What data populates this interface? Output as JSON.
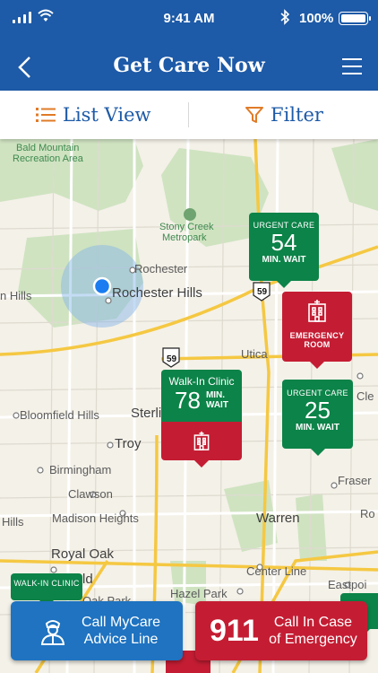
{
  "status_bar": {
    "time": "9:41 AM",
    "battery": "100%"
  },
  "header": {
    "title": "Get Care Now"
  },
  "subbar": {
    "list_view": "List View",
    "filter": "Filter"
  },
  "map_labels": {
    "bald_mountain_1": "Bald Mountain",
    "bald_mountain_2": "Recreation Area",
    "stony_creek_1": "Stony Creek",
    "stony_creek_2": "Metropark",
    "rochester": "Rochester",
    "rochester_hills": "Rochester Hills",
    "n_hills": "n Hills",
    "utica": "Utica",
    "cle": "Cle",
    "bloomfield_hills": "Bloomfield Hills",
    "sterling_heights": "Sterling Heights",
    "troy": "Troy",
    "birmingham": "Birmingham",
    "clawson": "Clawson",
    "fraser": "Fraser",
    "hills": "Hills",
    "madison_heights": "Madison Heights",
    "warren": "Warren",
    "ro": "Ro",
    "royal_oak": "Royal Oak",
    "center_line": "Center Line",
    "eastpoi": "Eastpoi",
    "oak_park": "Oak Park",
    "hazel_park": "Hazel Park",
    "ld": "ld",
    "route_59a": "59",
    "route_59b": "59"
  },
  "markers": {
    "urgent_care_1": {
      "type": "URGENT CARE",
      "wait": "54",
      "unit": "MIN. WAIT"
    },
    "emergency": {
      "type_line1": "EMERGENCY",
      "type_line2": "ROOM"
    },
    "walk_in_1": {
      "type": "Walk-In Clinic",
      "wait": "78",
      "unit_line1": "MIN.",
      "unit_line2": "WAIT"
    },
    "urgent_care_2": {
      "type": "URGENT CARE",
      "wait": "25",
      "unit": "MIN. WAIT"
    },
    "walk_in_2": {
      "type": "WALK-IN CLINIC"
    }
  },
  "buttons": {
    "mycare_line1": "Call MyCare",
    "mycare_line2": "Advice Line",
    "emergency_number": "911",
    "emergency_line1": "Call In Case",
    "emergency_line2": "of Emergency"
  },
  "colors": {
    "header_blue": "#1d5aa7",
    "urgent_green": "#0c8348",
    "emergency_red": "#c41d33",
    "call_blue": "#1f73c1"
  }
}
